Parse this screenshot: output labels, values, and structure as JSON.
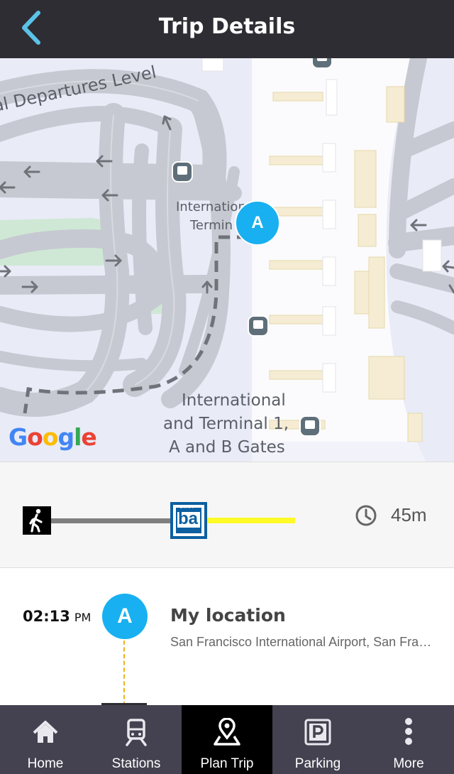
{
  "header": {
    "title": "Trip Details"
  },
  "map": {
    "labels": {
      "departures": "al Departures Level",
      "terminal_upper_1": "Internation",
      "terminal_upper_2": "Termin",
      "terminal_lower_1": "International",
      "terminal_lower_2": "and Terminal 1,",
      "terminal_lower_3": "A and B Gates"
    },
    "google_logo": [
      "G",
      "o",
      "o",
      "g",
      "l",
      "e"
    ],
    "marker_label": "A"
  },
  "route_summary": {
    "duration": "45m",
    "bart_logo": "ba",
    "bart_small": "BART"
  },
  "steps": [
    {
      "time": "02:13",
      "ampm": "PM",
      "marker": "A",
      "title": "My location",
      "subtitle": "San Francisco International Airport, San Francisco, CA"
    }
  ],
  "nav": {
    "items": [
      {
        "label": "Home",
        "icon": "home-icon"
      },
      {
        "label": "Stations",
        "icon": "train-icon"
      },
      {
        "label": "Plan Trip",
        "icon": "map-pin-icon",
        "active": true
      },
      {
        "label": "Parking",
        "icon": "parking-icon"
      },
      {
        "label": "More",
        "icon": "more-vertical-icon"
      }
    ]
  },
  "colors": {
    "header_bg": "#2e2d33",
    "accent": "#18b0f0",
    "back_arrow": "#5bc2e7",
    "bart_yellow": "#fffa28",
    "nav_bg": "#444250"
  }
}
